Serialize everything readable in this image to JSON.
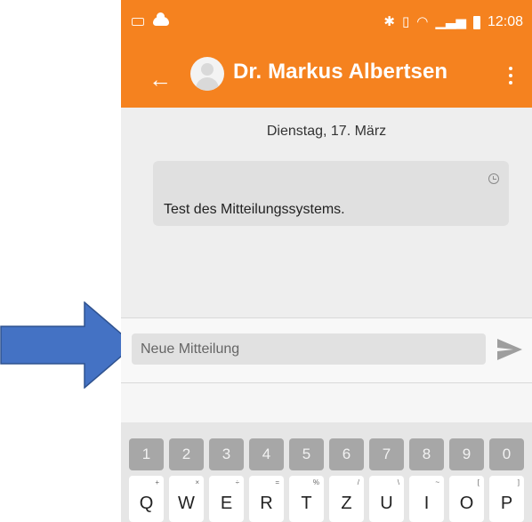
{
  "status_bar": {
    "time": "12:08",
    "left_icons": [
      "keyboard-icon",
      "cloud-icon"
    ],
    "right_icons": [
      "bluetooth-icon",
      "vibrate-icon",
      "wifi-icon",
      "signal-icon",
      "battery-icon"
    ]
  },
  "app_bar": {
    "contact_name": "Dr. Markus Albertsen",
    "back_icon": "back-arrow-icon",
    "menu_icon": "more-vert-icon",
    "avatar_icon": "person-avatar-icon"
  },
  "chat": {
    "date": "Dienstag, 17. März",
    "messages": [
      {
        "text": "Test des Mitteilungssystems.",
        "status_icon": "clock-icon"
      }
    ]
  },
  "composer": {
    "placeholder": "Neue Mitteilung",
    "send_icon": "send-icon"
  },
  "keyboard": {
    "numbers": [
      "1",
      "2",
      "3",
      "4",
      "5",
      "6",
      "7",
      "8",
      "9",
      "0"
    ],
    "qwerty": [
      {
        "key": "Q",
        "alt": "+"
      },
      {
        "key": "W",
        "alt": "×"
      },
      {
        "key": "E",
        "alt": "÷"
      },
      {
        "key": "R",
        "alt": "="
      },
      {
        "key": "T",
        "alt": "%"
      },
      {
        "key": "Z",
        "alt": "/"
      },
      {
        "key": "U",
        "alt": "\\"
      },
      {
        "key": "I",
        "alt": "~"
      },
      {
        "key": "O",
        "alt": "["
      },
      {
        "key": "P",
        "alt": "]"
      }
    ]
  },
  "annotation": {
    "arrow_color": "#4472c4",
    "arrow_border": "#2f528f"
  },
  "colors": {
    "accent": "#f5821f",
    "chat_background": "#eeeeee",
    "bubble": "#e0e0e0"
  }
}
